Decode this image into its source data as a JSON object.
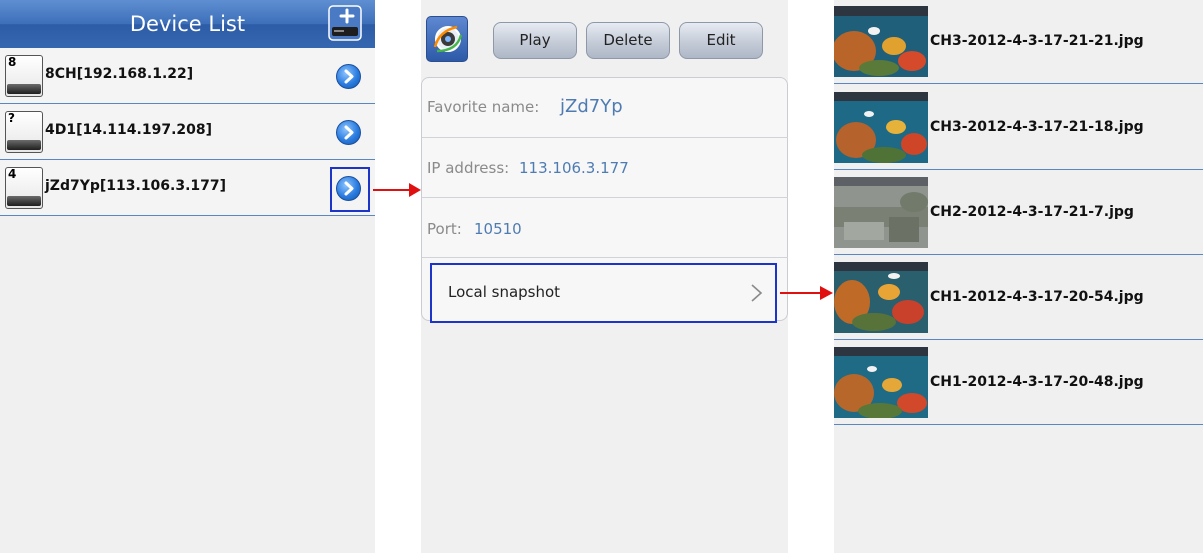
{
  "device_list": {
    "title": "Device List",
    "add_icon": "add-device-icon",
    "devices": [
      {
        "channel_badge": "8",
        "name": "8CH[192.168.1.22]"
      },
      {
        "channel_badge": "?",
        "name": "4D1[14.114.197.208]"
      },
      {
        "channel_badge": "4",
        "name": "jZd7Yp[113.106.3.177]"
      }
    ]
  },
  "device_detail": {
    "toolbar": {
      "app_icon": "camera-app-icon",
      "play_label": "Play",
      "delete_label": "Delete",
      "edit_label": "Edit"
    },
    "fields": {
      "favorite_label": "Favorite name:",
      "favorite_value": "jZd7Yp",
      "ip_label": "IP address:",
      "ip_value": "113.106.3.177",
      "port_label": "Port:",
      "port_value": "10510"
    },
    "local_snapshot_label": "Local snapshot"
  },
  "snapshots": {
    "files": [
      {
        "name": "CH3-2012-4-3-17-21-21.jpg",
        "scene": "aquarium"
      },
      {
        "name": "CH3-2012-4-3-17-21-18.jpg",
        "scene": "aquarium"
      },
      {
        "name": "CH2-2012-4-3-17-21-7.jpg",
        "scene": "outdoor"
      },
      {
        "name": "CH1-2012-4-3-17-20-54.jpg",
        "scene": "aquarium"
      },
      {
        "name": "CH1-2012-4-3-17-20-48.jpg",
        "scene": "aquarium"
      }
    ]
  },
  "colors": {
    "header_blue": "#3d6fb9",
    "divider_blue": "#5a86c2",
    "highlight_box": "#1c35c8",
    "arrow_red": "#e01010",
    "value_text": "#4e7cb2"
  }
}
